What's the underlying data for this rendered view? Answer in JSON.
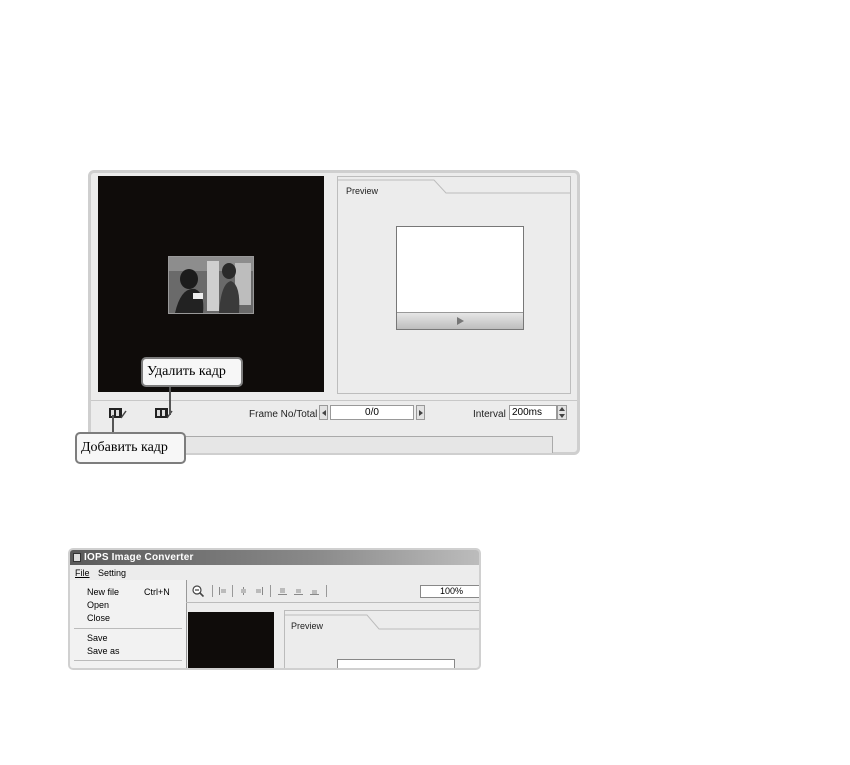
{
  "screen1": {
    "preview_label": "Preview",
    "frame_label": "Frame No/Total",
    "frame_value": "0/0",
    "interval_label": "Interval",
    "interval_value": "200ms",
    "callout_delete": "Удалить кадр",
    "callout_add": "Добавить кадр"
  },
  "screen2": {
    "app_title": "IOPS Image Converter",
    "menu": {
      "file": "File",
      "setting": "Setting"
    },
    "file_menu_items": [
      "New file",
      "Open",
      "Close",
      "Save",
      "Save as"
    ],
    "new_file_shortcut": "Ctrl+N",
    "zoom_value": "100%",
    "preview_label": "Preview"
  }
}
